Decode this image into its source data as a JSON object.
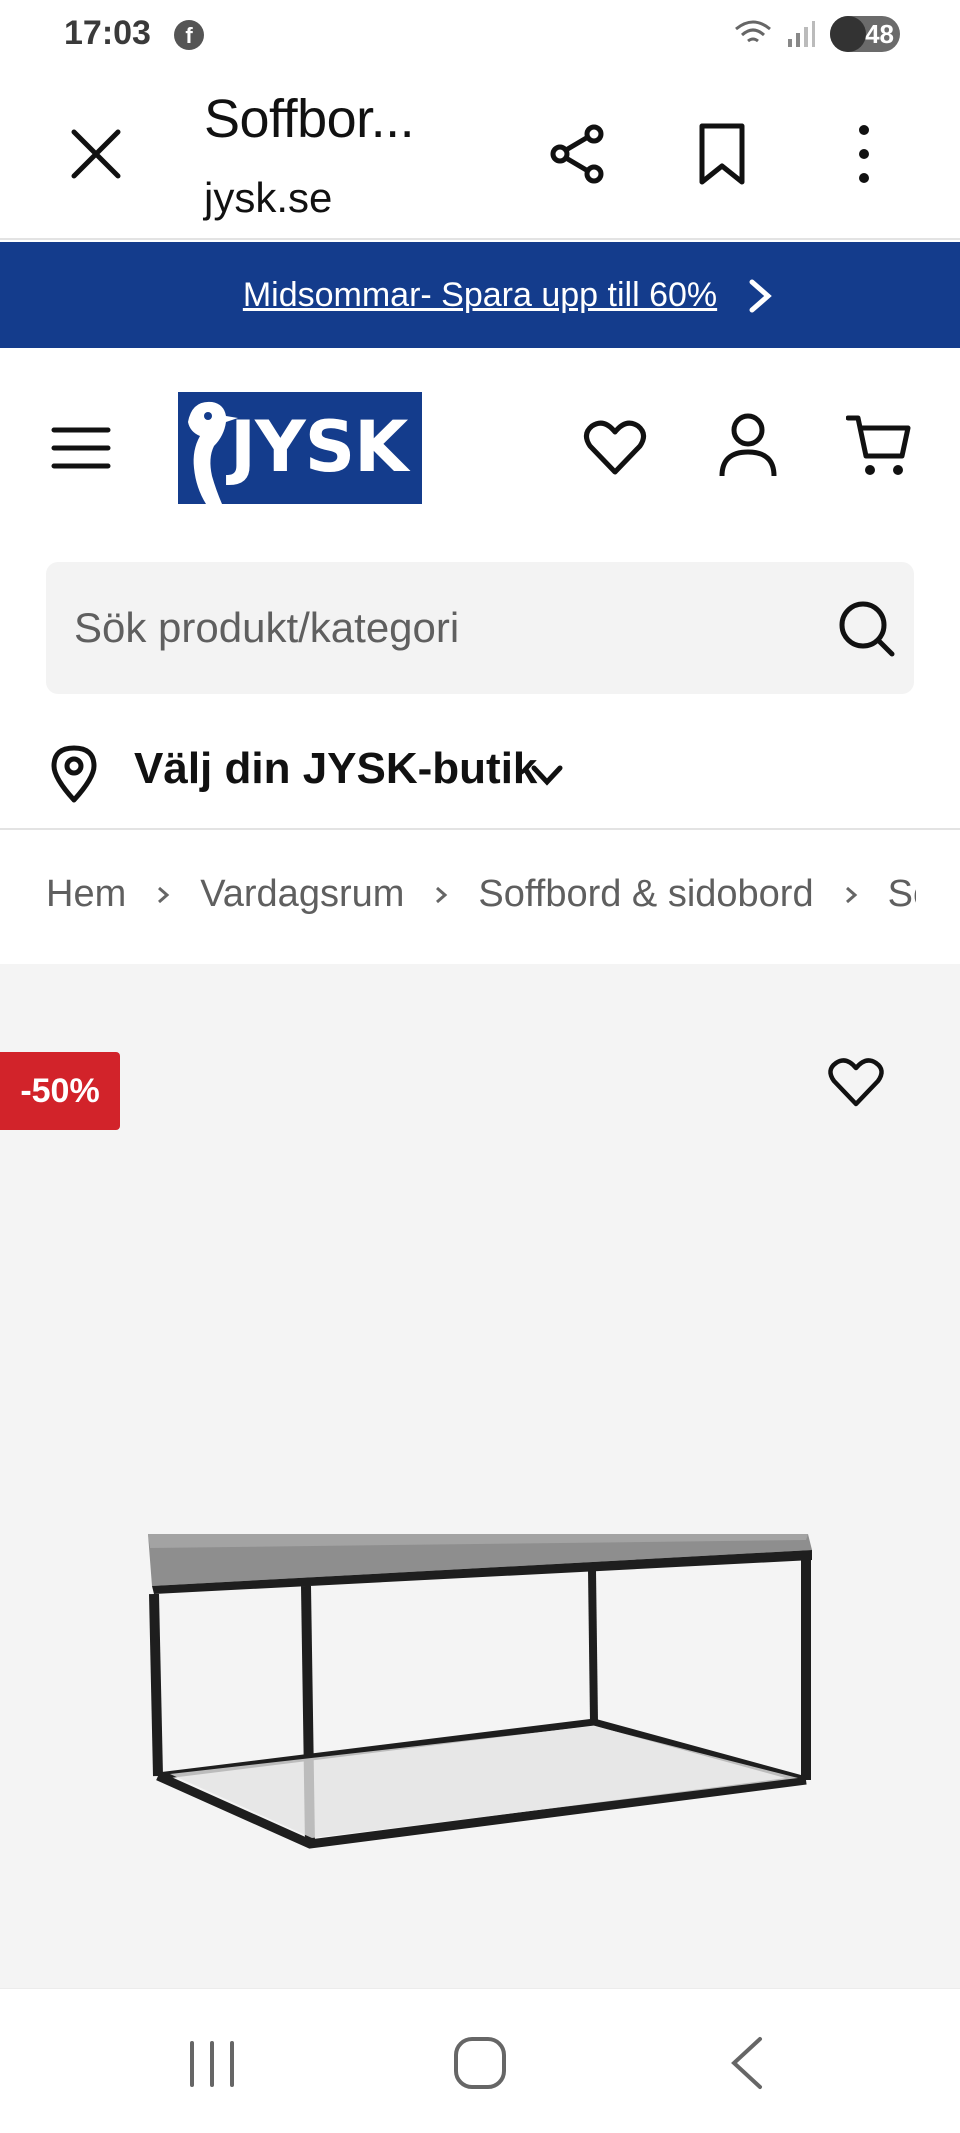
{
  "status_bar": {
    "time": "17:03",
    "notification_icon": "facebook-icon",
    "battery": "48"
  },
  "browser": {
    "title": "Soffbor...",
    "url": "jysk.se"
  },
  "promo": {
    "text": "Midsommar- Spara upp till 60%"
  },
  "header": {
    "logo_text": "JYSK"
  },
  "search": {
    "placeholder": "Sök produkt/kategori"
  },
  "store": {
    "label": "Välj din JYSK-butik"
  },
  "breadcrumb": {
    "items": [
      "Hem",
      "Vardagsrum",
      "Soffbord & sidobord",
      "So"
    ]
  },
  "product": {
    "discount": "-50%"
  },
  "colors": {
    "brand_blue": "#143c8c",
    "discount_red": "#d2232a"
  }
}
